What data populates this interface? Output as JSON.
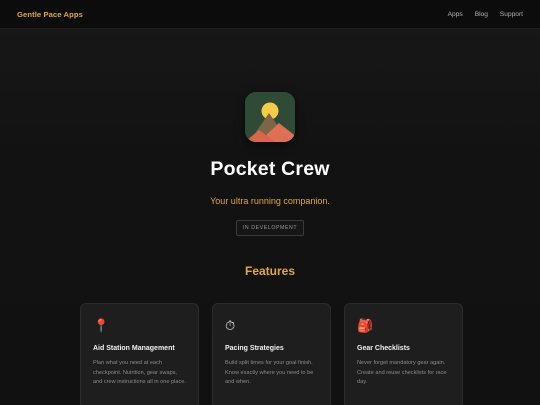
{
  "header": {
    "brand": "Gentle Pace Apps",
    "nav": [
      {
        "label": "Apps"
      },
      {
        "label": "Blog"
      },
      {
        "label": "Support"
      }
    ]
  },
  "hero": {
    "title": "Pocket Crew",
    "tagline": "Your ultra running companion.",
    "badge": "IN DEVELOPMENT"
  },
  "features": {
    "heading": "Features",
    "cards": [
      {
        "icon": "pushpin-icon",
        "glyph": "📍",
        "title": "Aid Station Management",
        "text": "Plan what you need at each checkpoint. Nutrition, gear swaps, and crew instructions all in one place."
      },
      {
        "icon": "stopwatch-icon",
        "glyph": "⏱",
        "title": "Pacing Strategies",
        "text": "Build split times for your goal finish. Know exactly where you need to be and when."
      },
      {
        "icon": "backpack-icon",
        "glyph": "🎒",
        "title": "Gear Checklists",
        "text": "Never forget mandatory gear again. Create and reuse checklists for race day."
      }
    ]
  },
  "colors": {
    "accent": "#e0a93a",
    "background": "#121212",
    "card": "#1e1e1f"
  }
}
